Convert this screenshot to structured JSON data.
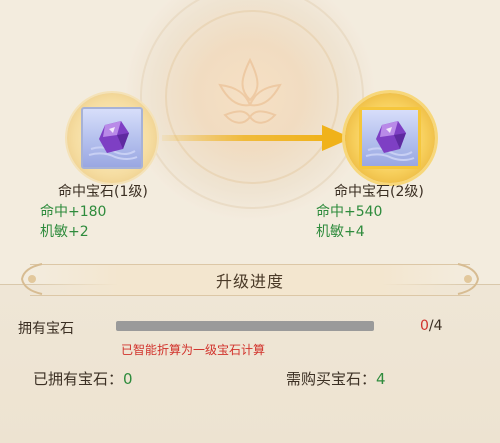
{
  "upgrade": {
    "from": {
      "name": "命中宝石(1级)",
      "stat1": "命中+180",
      "stat2": "机敏+2",
      "gem_icon": "purple-gem-icon"
    },
    "to": {
      "name": "命中宝石(2级)",
      "stat1": "命中+540",
      "stat2": "机敏+4",
      "gem_icon": "purple-gem-icon"
    },
    "arrow_icon": "right-arrow-icon",
    "accent": "#f0b21a"
  },
  "progress": {
    "title": "升级进度",
    "label": "拥有宝石",
    "current": "0",
    "sep_total": "/4",
    "fraction": 0.0,
    "note": "已智能折算为一级宝石计算",
    "owned_label": "已拥有宝石：",
    "owned_value": "0",
    "need_label": "需购买宝石：",
    "need_value": "4"
  },
  "colors": {
    "positive": "#2e8b3c",
    "warning": "#d1322b"
  }
}
